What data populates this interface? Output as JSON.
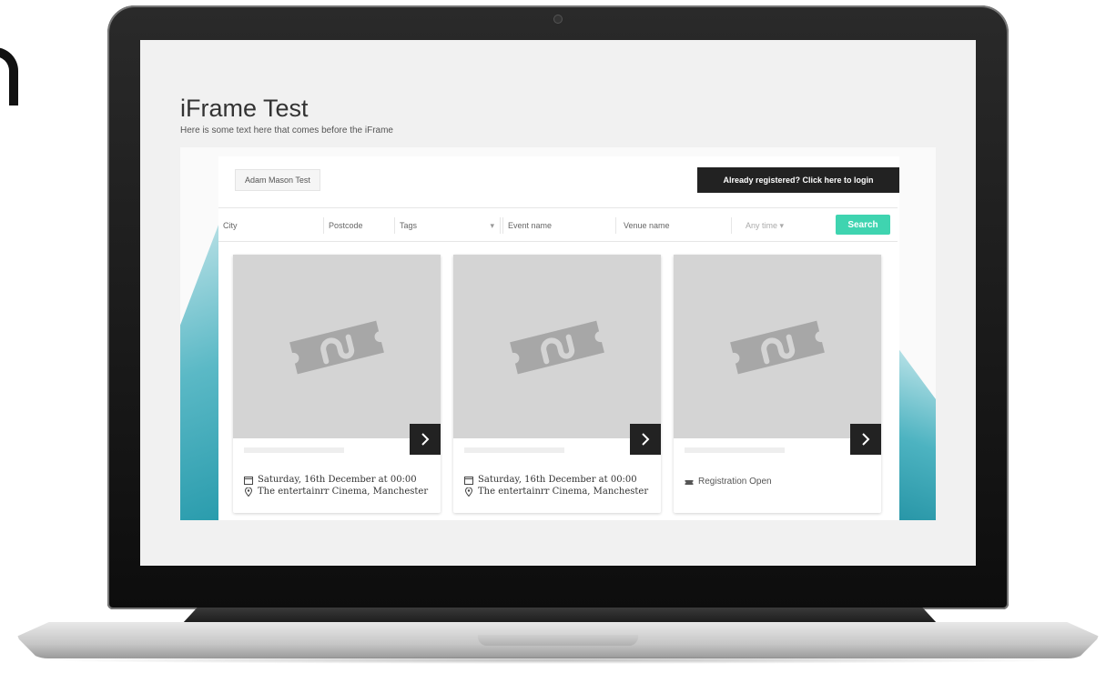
{
  "page": {
    "title": "iFrame Test",
    "subtitle": "Here is some text here that comes before the iFrame"
  },
  "iframe": {
    "organizer_label": "Adam Mason Test",
    "login_label": "Already registered? Click here to login",
    "filters": {
      "city_placeholder": "City",
      "postcode_placeholder": "Postcode",
      "tags_placeholder": "Tags",
      "event_placeholder": "Event name",
      "venue_placeholder": "Venue name",
      "time_value": "Any time",
      "search_label": "Search"
    },
    "events": [
      {
        "date": "Saturday, 16th December at 00:00",
        "venue": "The entertainrr Cinema, Manchester"
      },
      {
        "date": "Saturday, 16th December at 00:00",
        "venue": "The entertainrr Cinema, Manchester"
      },
      {
        "status": "Registration Open"
      }
    ]
  },
  "colors": {
    "search_button": "#3fd4b0",
    "login_button": "#222222",
    "accent_wave": "#2a9cad"
  }
}
